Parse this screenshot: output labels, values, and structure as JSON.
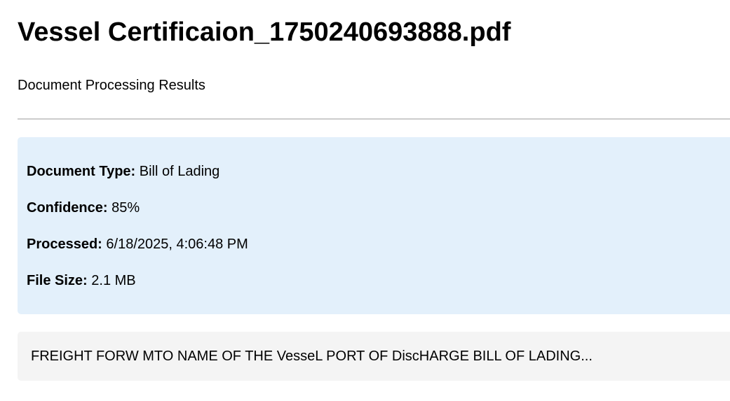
{
  "document": {
    "title": "Vessel Certificaion_1750240693888.pdf",
    "subtitle": "Document Processing Results"
  },
  "info": {
    "type_label": "Document Type:",
    "type_value": "Bill of Lading",
    "confidence_label": "Confidence:",
    "confidence_value": "85%",
    "processed_label": "Processed:",
    "processed_value": "6/18/2025, 4:06:48 PM",
    "size_label": "File Size:",
    "size_value": "2.1 MB"
  },
  "excerpt": {
    "text": "FREIGHT FORW MTO NAME OF THE VesseL PORT OF DiscHARGE BILL OF LADING..."
  },
  "colors": {
    "info_background": "#e3f0fb",
    "excerpt_background": "#f4f4f4",
    "divider": "#cccccc"
  }
}
